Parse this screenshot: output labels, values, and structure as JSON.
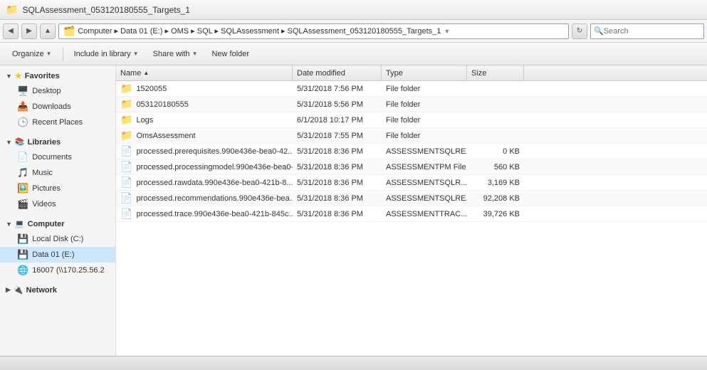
{
  "titleBar": {
    "title": "SQLAssessment_053120180555_Targets_1",
    "icon": "📁"
  },
  "addressBar": {
    "backBtn": "◀",
    "forwardBtn": "▶",
    "upBtn": "▲",
    "path": "Computer ▸ Data 01 (E:) ▸ OMS ▸ SQL ▸ SQLAssessment ▸ SQLAssessment_053120180555_Targets_1",
    "searchPlaceholder": "Search",
    "searchLabel": "Search"
  },
  "toolbar": {
    "organizeLabel": "Organize",
    "includeLibraryLabel": "Include in library",
    "shareWithLabel": "Share with",
    "newFolderLabel": "New folder"
  },
  "sidebar": {
    "favoritesHeader": "Favorites",
    "favorites": [
      {
        "id": "desktop",
        "label": "Desktop",
        "icon": "🖥️"
      },
      {
        "id": "downloads",
        "label": "Downloads",
        "icon": "📥"
      },
      {
        "id": "recent-places",
        "label": "Recent Places",
        "icon": "🕒"
      }
    ],
    "librariesHeader": "Libraries",
    "libraries": [
      {
        "id": "documents",
        "label": "Documents",
        "icon": "📄"
      },
      {
        "id": "music",
        "label": "Music",
        "icon": "🎵"
      },
      {
        "id": "pictures",
        "label": "Pictures",
        "icon": "🖼️"
      },
      {
        "id": "videos",
        "label": "Videos",
        "icon": "🎬"
      }
    ],
    "computerHeader": "Computer",
    "computer": [
      {
        "id": "local-disk-c",
        "label": "Local Disk (C:)",
        "icon": "💾"
      },
      {
        "id": "data-01-e",
        "label": "Data 01 (E:)",
        "icon": "💾",
        "active": true
      },
      {
        "id": "network-share",
        "label": "16007 (\\\\170.25.56.2",
        "icon": "🌐"
      }
    ],
    "networkHeader": "Network",
    "networkItems": []
  },
  "fileList": {
    "columns": [
      {
        "id": "name",
        "label": "Name",
        "sortArrow": "▲"
      },
      {
        "id": "date-modified",
        "label": "Date modified",
        "sortArrow": ""
      },
      {
        "id": "type",
        "label": "Type",
        "sortArrow": ""
      },
      {
        "id": "size",
        "label": "Size",
        "sortArrow": ""
      }
    ],
    "rows": [
      {
        "id": "row-1520055",
        "name": "1520055",
        "dateModified": "5/31/2018 7:56 PM",
        "type": "File folder",
        "size": "",
        "icon": "folder"
      },
      {
        "id": "row-053120180555",
        "name": "053120180555",
        "dateModified": "5/31/2018 5:56 PM",
        "type": "File folder",
        "size": "",
        "icon": "folder"
      },
      {
        "id": "row-logs",
        "name": "Logs",
        "dateModified": "6/1/2018 10:17 PM",
        "type": "File folder",
        "size": "",
        "icon": "folder"
      },
      {
        "id": "row-omsassessment",
        "name": "OmsAssessment",
        "dateModified": "5/31/2018 7:55 PM",
        "type": "File folder",
        "size": "",
        "icon": "folder"
      },
      {
        "id": "row-prerequisites",
        "name": "processed.prerequisites.990e436e-bea0-42...",
        "dateModified": "5/31/2018 8:36 PM",
        "type": "ASSESSMENTSQLRE...",
        "size": "0 KB",
        "icon": "doc"
      },
      {
        "id": "row-processingmodel",
        "name": "processed.processingmodel.990e436e-bea0-...",
        "dateModified": "5/31/2018 8:36 PM",
        "type": "ASSESSMENTPM File",
        "size": "560 KB",
        "icon": "doc"
      },
      {
        "id": "row-rawdata",
        "name": "processed.rawdata.990e436e-bea0-421b-8...",
        "dateModified": "5/31/2018 8:36 PM",
        "type": "ASSESSMENTSQLR...",
        "size": "3,169 KB",
        "icon": "doc"
      },
      {
        "id": "row-recommendations",
        "name": "processed.recommendations.990e436e-bea...",
        "dateModified": "5/31/2018 8:36 PM",
        "type": "ASSESSMENTSQLRE...",
        "size": "92,208 KB",
        "icon": "doc"
      },
      {
        "id": "row-trace",
        "name": "processed.trace.990e436e-bea0-421b-845c...",
        "dateModified": "5/31/2018 8:36 PM",
        "type": "ASSESSMENTTRAC...",
        "size": "39,726 KB",
        "icon": "doc"
      }
    ]
  },
  "statusBar": {
    "text": ""
  }
}
